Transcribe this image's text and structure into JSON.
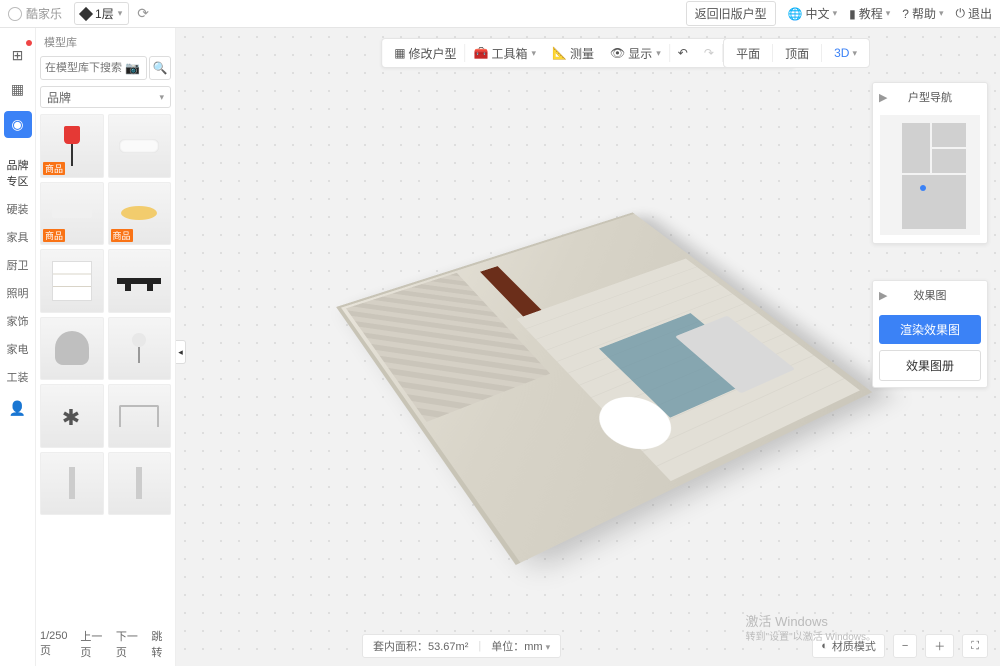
{
  "header": {
    "app_name": "酷家乐",
    "floor_label": "1层",
    "legacy_btn": "返回旧版户型",
    "lang_label": "中文",
    "tutorial_label": "教程",
    "help_label": "帮助",
    "exit_label": "退出"
  },
  "rail": {
    "brand_section": "品牌专区",
    "cats": [
      "硬装",
      "家具",
      "厨卫",
      "照明",
      "家饰",
      "家电",
      "工装"
    ]
  },
  "panel": {
    "title": "模型库",
    "search_placeholder": "在模型库下搜索",
    "filter_label": "品牌",
    "items": [
      {
        "tag": "商品",
        "thumb": "lamp"
      },
      {
        "tag": "",
        "thumb": "ceil"
      },
      {
        "tag": "商品",
        "thumb": "ceil2"
      },
      {
        "tag": "商品",
        "thumb": "round"
      },
      {
        "tag": "",
        "thumb": "shelf"
      },
      {
        "tag": "",
        "thumb": "track"
      },
      {
        "tag": "",
        "thumb": "chair"
      },
      {
        "tag": "",
        "thumb": "table"
      },
      {
        "tag": "",
        "thumb": "chand"
      },
      {
        "tag": "",
        "thumb": "desk"
      },
      {
        "tag": "",
        "thumb": "pend"
      },
      {
        "tag": "",
        "thumb": "pend"
      }
    ],
    "page_info": "1/250页",
    "prev": "上一页",
    "next": "下一页",
    "jump": "跳转"
  },
  "toolbar": {
    "edit_plan": "修改户型",
    "toolbox": "工具箱",
    "measure": "测量",
    "display": "显示",
    "views": {
      "plan": "平面",
      "ceiling": "顶面",
      "threeD": "3D"
    }
  },
  "nav_panel": {
    "title": "户型导航"
  },
  "render_panel": {
    "title": "效果图",
    "render_btn": "渲染效果图",
    "album_btn": "效果图册"
  },
  "status": {
    "area_label": "套内面积：",
    "area_value": "53.67m²",
    "unit_label": "单位：",
    "unit_value": "mm",
    "material_mode": "材质模式"
  },
  "watermark": {
    "line1": "激活 Windows",
    "line2": "转到\"设置\"以激活 Windows。"
  }
}
